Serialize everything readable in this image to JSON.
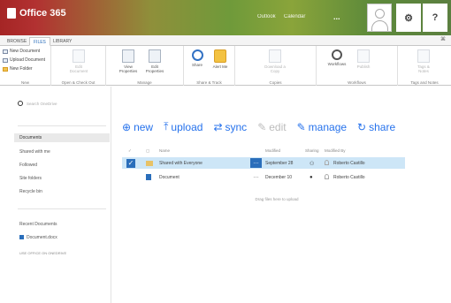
{
  "suite": {
    "brand": "Office 365",
    "nav": [
      "Outlook",
      "Calendar"
    ],
    "more": "...",
    "settings_glyph": "⚙",
    "help_glyph": "?"
  },
  "ribbon": {
    "tabs": [
      "BROWSE",
      "FILES",
      "LIBRARY"
    ],
    "active_tab": "FILES",
    "collapse_glyph": "⌘",
    "groups": {
      "new": {
        "label": "New",
        "buttons": [
          "New Document",
          "Upload Document",
          "New Folder"
        ]
      },
      "open_checkout": {
        "label": "Open & Check Out",
        "buttons": [
          "Edit Document"
        ]
      },
      "manage": {
        "label": "Manage",
        "buttons": [
          "View Properties",
          "Edit Properties"
        ]
      },
      "share_track": {
        "label": "Share & Track",
        "buttons": [
          "Share",
          "Alert Me"
        ]
      },
      "copies": {
        "label": "Copies",
        "buttons": [
          "Download a Copy"
        ]
      },
      "workflows": {
        "label": "Workflows",
        "buttons": [
          "Workflows",
          "Publish"
        ]
      },
      "tags_notes": {
        "label": "Tags and Notes",
        "buttons": [
          "Tags & Notes"
        ]
      }
    }
  },
  "leftnav": {
    "search_placeholder": "Search OneDrive",
    "items": [
      "Documents",
      "Shared with me",
      "Followed",
      "Site folders",
      "Recycle bin"
    ],
    "recent_title": "Recent Documents",
    "recent_items": [
      "Document.docx"
    ],
    "footer_link": "USE OFFICE ON ONEDRIVE"
  },
  "commands": {
    "new": "new",
    "upload": "upload",
    "sync": "sync",
    "edit": "edit",
    "manage": "manage",
    "share": "share"
  },
  "columns": [
    "Name",
    "Modified",
    "Sharing",
    "Modified By"
  ],
  "rows": [
    {
      "name": "Shared with Everyone",
      "modified": "September 28",
      "modified_by": "Roberto Castillo",
      "type": "folder",
      "selected": true
    },
    {
      "name": "Document",
      "modified": "December 10",
      "modified_by": "Roberto Castillo",
      "type": "doc",
      "selected": false
    }
  ],
  "drag_hint": "Drag files here to upload"
}
